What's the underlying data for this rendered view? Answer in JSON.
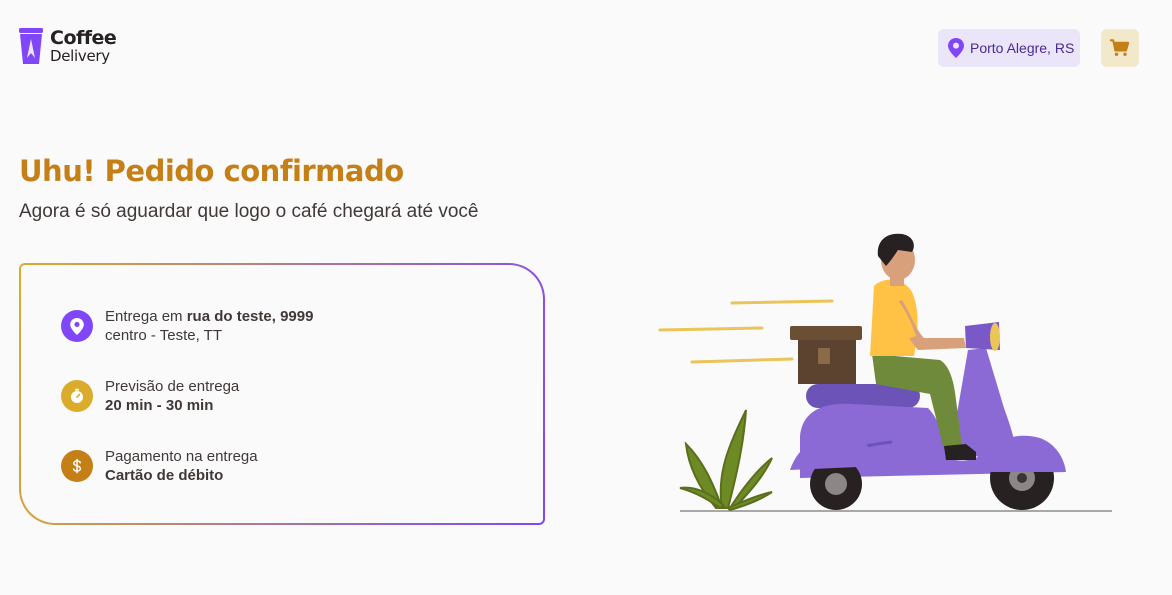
{
  "header": {
    "logo_brand": "Coffee",
    "logo_sub": "Delivery",
    "location": "Porto Alegre, RS",
    "colors": {
      "purple": "#8047F8",
      "purple_light": "#EBE5F9",
      "yellow_dark": "#C47F17",
      "yellow_light": "#F1E9C9"
    }
  },
  "confirmation": {
    "title": "Uhu! Pedido confirmado",
    "subtitle": "Agora é só aguardar que logo o café chegará até você"
  },
  "delivery": {
    "address_prefix": "Entrega em ",
    "address_street": "rua do teste, 9999",
    "address_line2": "centro - Teste, TT",
    "eta_label": "Previsão de entrega",
    "eta_value": "20 min - 30 min",
    "payment_label": "Pagamento na entrega",
    "payment_value": "Cartão de débito",
    "icons": [
      "map-pin-icon",
      "timer-icon",
      "currency-dollar-icon"
    ],
    "icon_colors": [
      "#8047F8",
      "#DBAC2C",
      "#C47F17"
    ]
  }
}
